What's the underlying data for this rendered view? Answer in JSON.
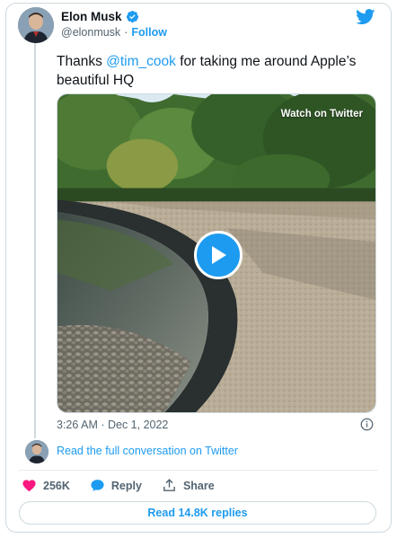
{
  "author": {
    "name": "Elon Musk",
    "handle": "@elonmusk",
    "separator": "·",
    "follow_label": "Follow"
  },
  "tweet": {
    "text_before": "Thanks ",
    "mention": "@tim_cook",
    "text_after": " for taking me around Apple’s beautiful HQ",
    "timestamp": "3:26 AM · Dec 1, 2022"
  },
  "media": {
    "overlay_label": "Watch on Twitter"
  },
  "conversation": {
    "link_label": "Read the full conversation on Twitter"
  },
  "actions": {
    "likes_count": "256K",
    "reply_label": "Reply",
    "share_label": "Share"
  },
  "replies_button": {
    "label": "Read 14.8K replies"
  },
  "colors": {
    "accent": "#1d9bf0",
    "like": "#f91880",
    "muted_text": "#536471",
    "border": "#cfd9de"
  },
  "icons": [
    "verified-badge-icon",
    "twitter-bird-icon",
    "play-icon",
    "info-icon",
    "heart-icon",
    "reply-bubble-icon",
    "share-icon"
  ]
}
